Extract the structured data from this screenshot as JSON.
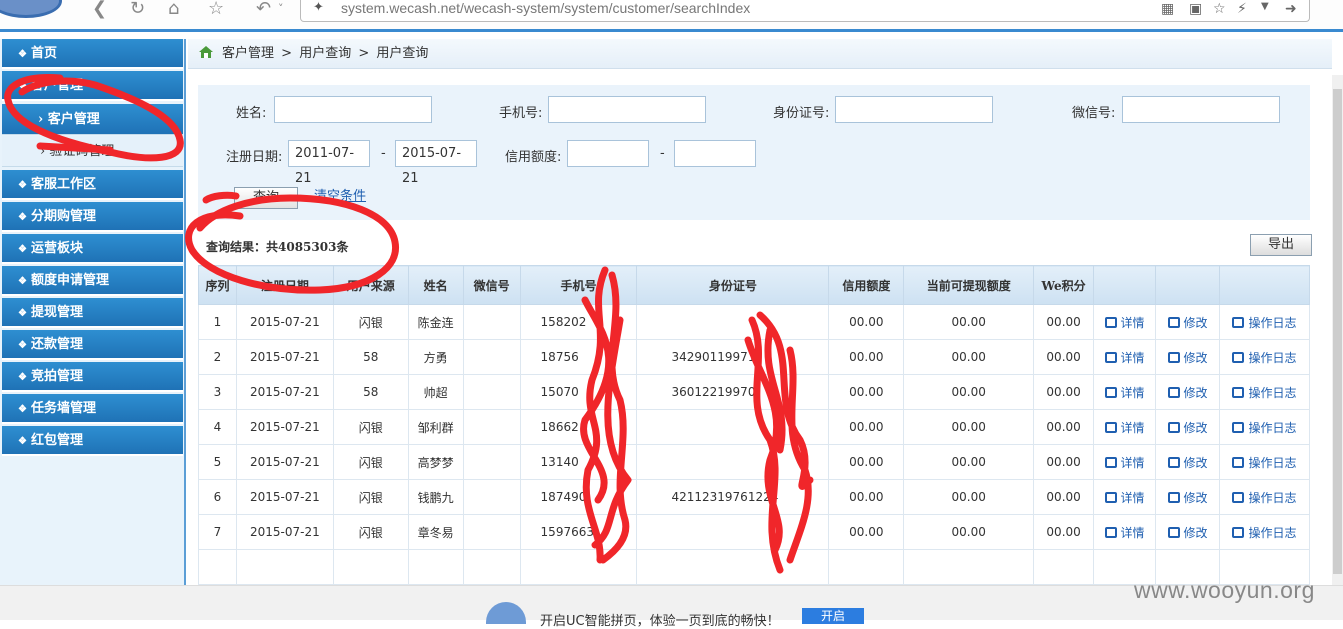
{
  "browser": {
    "url": "system.wecash.net/wecash-system/system/customer/searchIndex",
    "icons": [
      "back-icon",
      "refresh-icon",
      "home-icon",
      "star-icon",
      "undo-icon",
      "qr-icon",
      "star-icon",
      "lightning-icon",
      "forward-icon"
    ]
  },
  "sidebar": {
    "items": [
      {
        "label": "首页"
      },
      {
        "label": "客户管理"
      },
      {
        "label": "客户管理",
        "sub": true,
        "active": true
      },
      {
        "label": "验证码管理",
        "sub": true
      },
      {
        "label": "客服工作区"
      },
      {
        "label": "分期购管理"
      },
      {
        "label": "运营板块"
      },
      {
        "label": "额度申请管理"
      },
      {
        "label": "提现管理"
      },
      {
        "label": "还款管理"
      },
      {
        "label": "竞拍管理"
      },
      {
        "label": "任务墙管理"
      },
      {
        "label": "红包管理"
      }
    ]
  },
  "breadcrumb": [
    "客户管理",
    "用户查询",
    "用户查询"
  ],
  "breadcrumb_sep": ">",
  "search": {
    "name_label": "姓名:",
    "phone_label": "手机号:",
    "id_label": "身份证号:",
    "wechat_label": "微信号:",
    "reg_label": "注册日期:",
    "date_from": "2011-07-21",
    "date_to": "2015-07-21",
    "range_sep": "-",
    "credit_label": "信用额度:",
    "query_btn": "查询",
    "clear_link": "清空条件"
  },
  "result_text": "查询结果：共4085303条",
  "export_btn": "导出",
  "table": {
    "headers": [
      "序列",
      "注册日期",
      "用户来源",
      "姓名",
      "微信号",
      "手机号",
      "身份证号",
      "信用额度",
      "当前可提现额度",
      "We积分",
      "",
      "",
      ""
    ],
    "rows": [
      [
        "1",
        "2015-07-21",
        "闪银",
        "陈金连",
        "",
        "158202",
        "",
        "00.00",
        "00.00",
        "00.00"
      ],
      [
        "2",
        "2015-07-21",
        "58",
        "方勇",
        "",
        "18756",
        "34290119971",
        "00.00",
        "00.00",
        "00.00"
      ],
      [
        "3",
        "2015-07-21",
        "58",
        "帅超",
        "",
        "15070",
        "36012219970",
        "00.00",
        "00.00",
        "00.00"
      ],
      [
        "4",
        "2015-07-21",
        "闪银",
        "邹利群",
        "",
        "18662",
        "",
        "00.00",
        "00.00",
        "00.00"
      ],
      [
        "5",
        "2015-07-21",
        "闪银",
        "高梦梦",
        "",
        "13140",
        "",
        "00.00",
        "00.00",
        "00.00"
      ],
      [
        "6",
        "2015-07-21",
        "闪银",
        "钱鹏九",
        "",
        "187490",
        "42112319761224",
        "00.00",
        "00.00",
        "00.00"
      ],
      [
        "7",
        "2015-07-21",
        "闪银",
        "章冬易",
        "",
        "1597663",
        "",
        "00.00",
        "00.00",
        "00.00"
      ]
    ],
    "actions": {
      "detail": "详情",
      "edit": "修改",
      "log": "操作日志"
    }
  },
  "bottombar": {
    "text": "开启UC智能拼页，体验一页到底的畅快！",
    "button": "开启"
  },
  "watermark": "www.wooyun.org",
  "colors": {
    "accent": "#2e8fd1",
    "scribble": "#f0262a",
    "link": "#1f5fb0"
  }
}
